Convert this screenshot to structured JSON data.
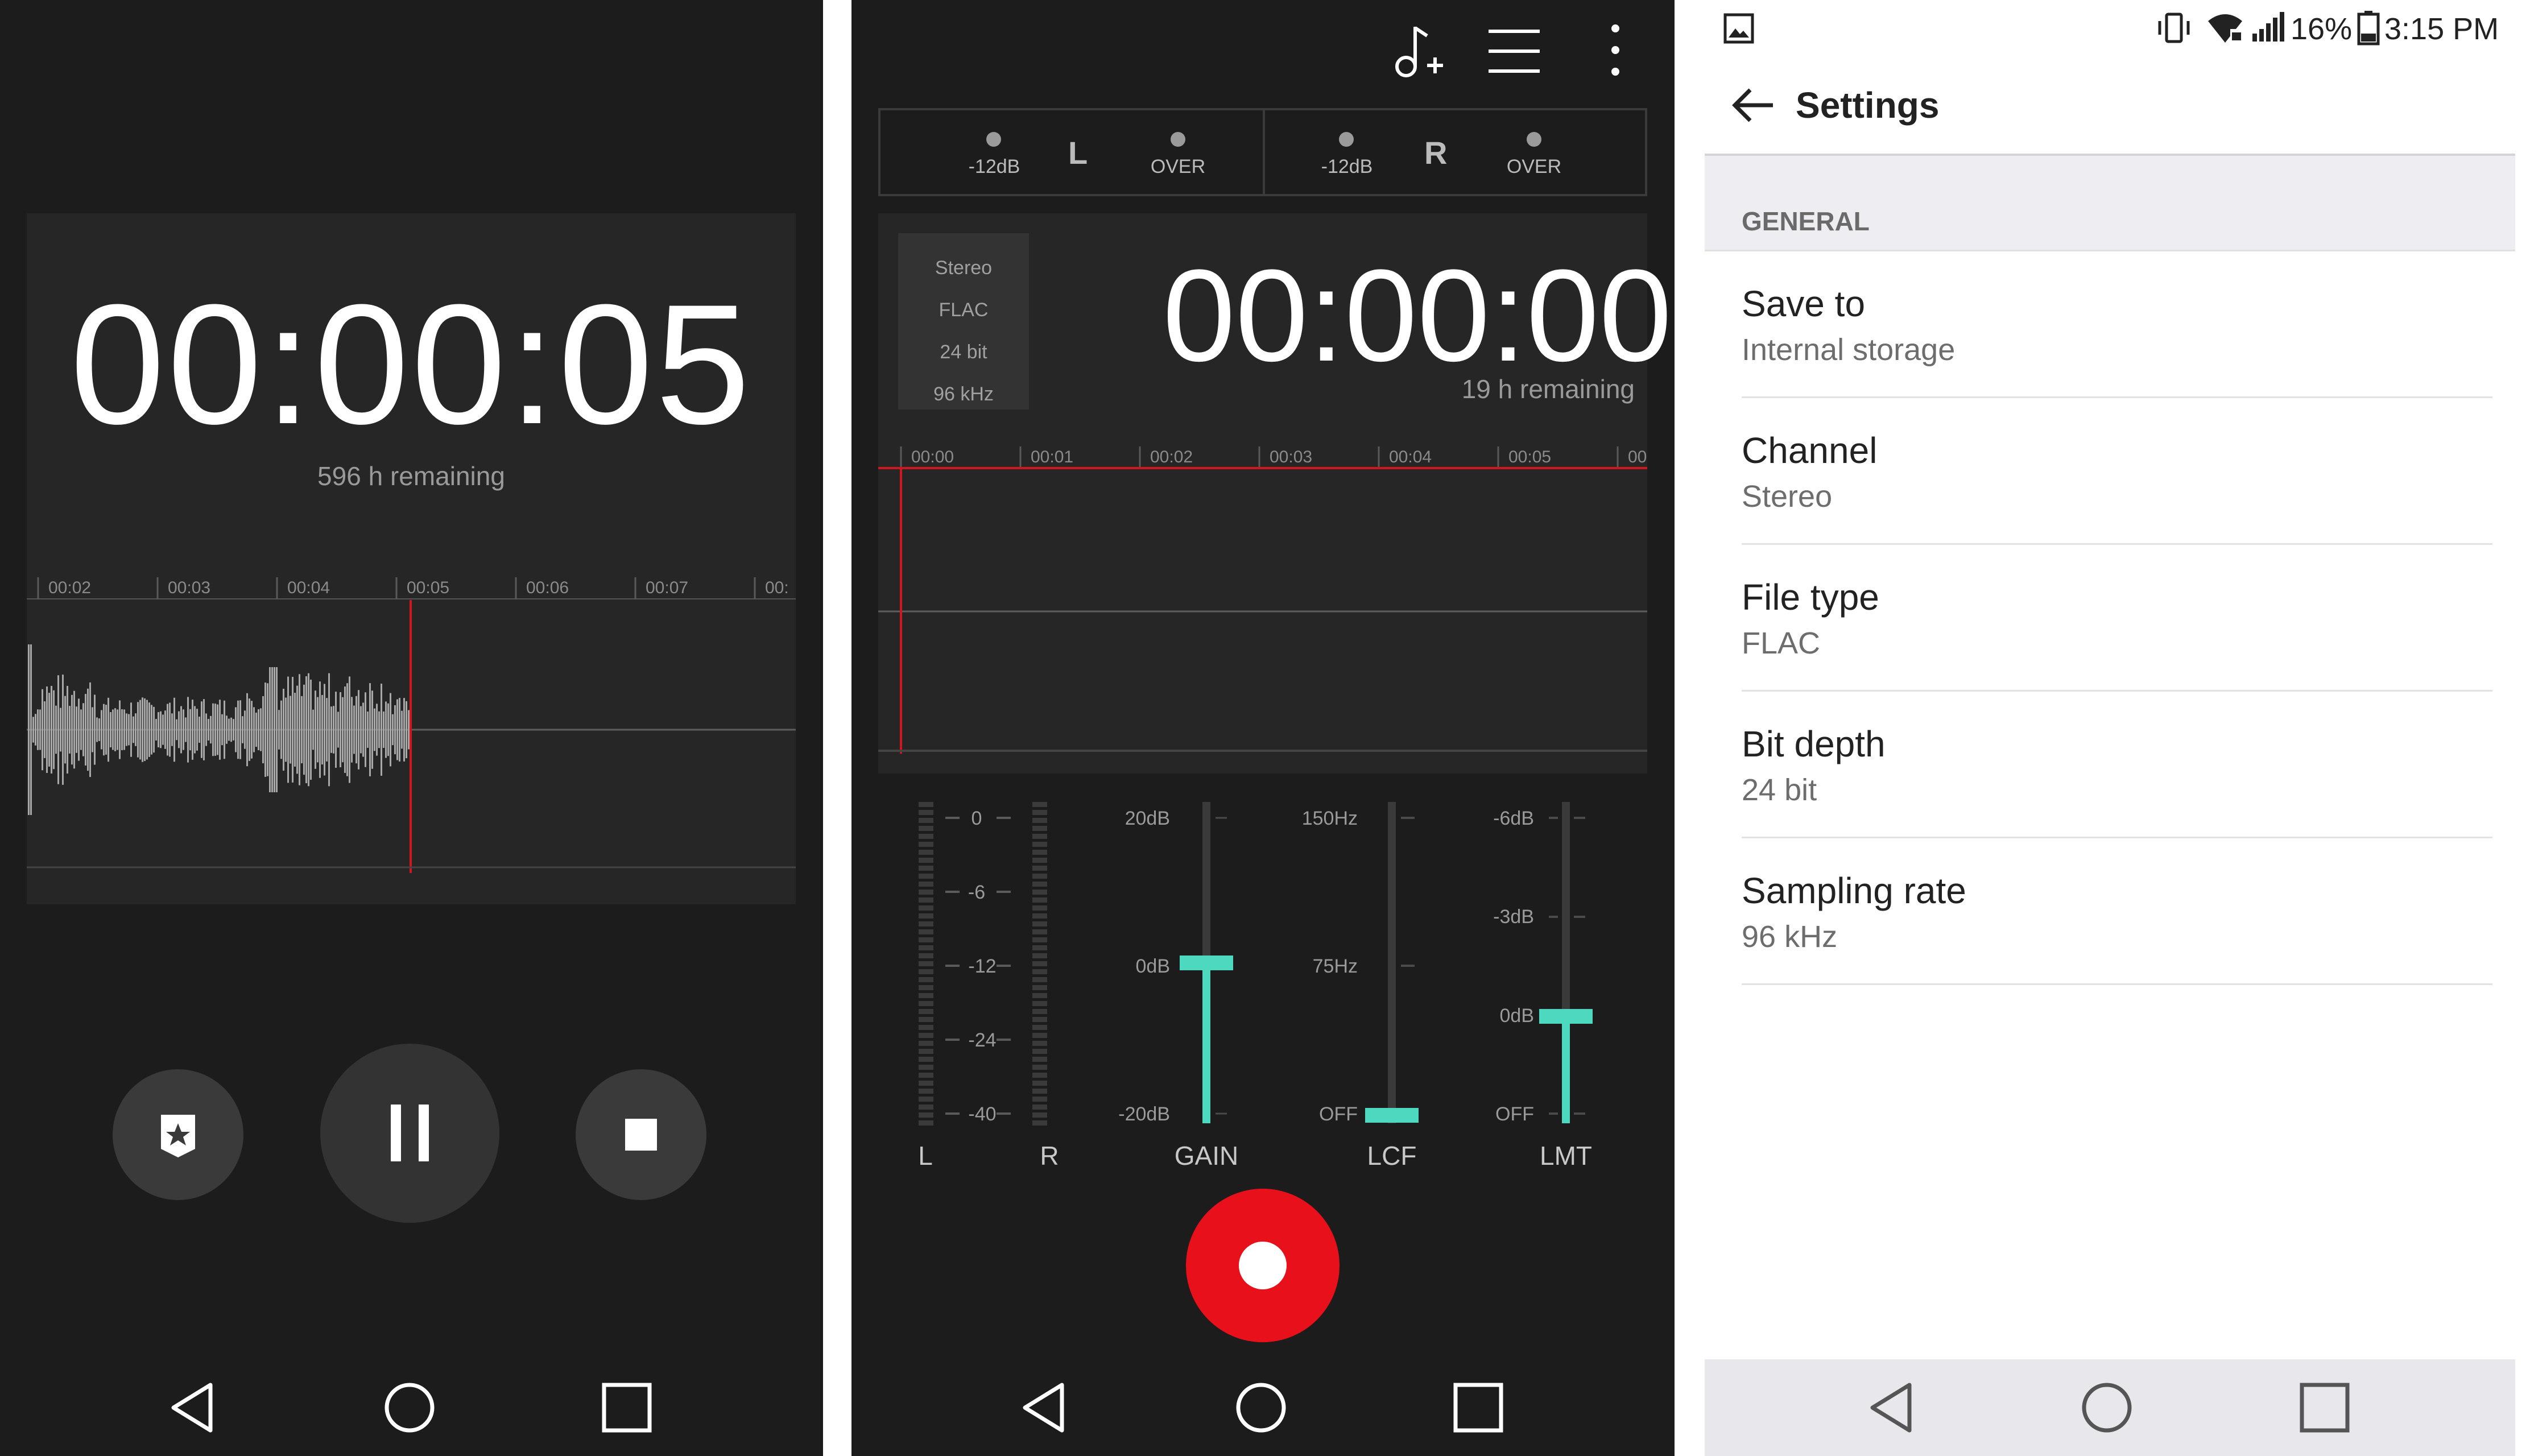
{
  "recording": {
    "timer": "00:00:05",
    "remaining": "596 h remaining",
    "timeline": [
      "00:02",
      "00:03",
      "00:04",
      "00:05",
      "00:06",
      "00:07",
      "00:"
    ],
    "bookmark_icon": "bookmark-star-icon",
    "pause_icon": "pause-icon",
    "stop_icon": "stop-icon"
  },
  "recorder": {
    "toolbar_icons": [
      "add-music-icon",
      "list-icon",
      "more-vert-icon"
    ],
    "meter": {
      "left": {
        "label_low": "-12dB",
        "channel": "L",
        "label_over": "OVER"
      },
      "right": {
        "label_low": "-12dB",
        "channel": "R",
        "label_over": "OVER"
      }
    },
    "info": {
      "channel": "Stereo",
      "format": "FLAC",
      "bit_depth": "24 bit",
      "rate": "96 kHz"
    },
    "timer": "00:00:00",
    "remaining": "19 h remaining",
    "timeline": [
      "00:00",
      "00:01",
      "00:02",
      "00:03",
      "00:04",
      "00:05",
      "00"
    ],
    "level_meter": {
      "ticks": [
        "0",
        "-6",
        "-12",
        "-24",
        "-40"
      ],
      "left_label": "L",
      "right_label": "R"
    },
    "gain": {
      "name": "GAIN",
      "top": "20dB",
      "mid": "0dB",
      "bottom": "-20dB",
      "value_fraction": 0.5
    },
    "lcf": {
      "name": "LCF",
      "top": "150Hz",
      "mid": "75Hz",
      "bottom": "OFF",
      "value_fraction": 0.0
    },
    "lmt": {
      "name": "LMT",
      "top": "-6dB",
      "mid": "-3dB",
      "mid2": "0dB",
      "bottom": "OFF",
      "value_fraction": 0.33
    },
    "record_icon": "record-icon",
    "accent_color": "#4dd9c0",
    "record_color": "#e8101a"
  },
  "settings": {
    "status": {
      "battery": "16%",
      "time": "3:15 PM"
    },
    "title": "Settings",
    "section": "GENERAL",
    "items": [
      {
        "title": "Save to",
        "value": "Internal storage"
      },
      {
        "title": "Channel",
        "value": "Stereo"
      },
      {
        "title": "File type",
        "value": "FLAC"
      },
      {
        "title": "Bit depth",
        "value": "24 bit"
      },
      {
        "title": "Sampling rate",
        "value": "96 kHz"
      }
    ]
  },
  "nav": {
    "back_icon": "nav-back-icon",
    "home_icon": "nav-home-icon",
    "recents_icon": "nav-recents-icon"
  }
}
